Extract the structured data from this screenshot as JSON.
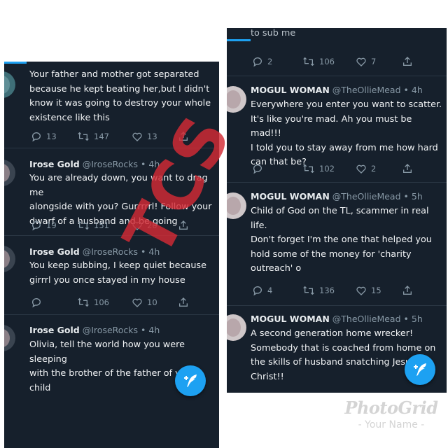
{
  "left_timeline": {
    "tweets": [
      {
        "name": "",
        "handle": "",
        "time": "",
        "text_lines": [
          "Your father and mother got separated",
          "because  he kept beating her,but I didn't",
          "know it was going to destroy  your whole",
          "existence  like this"
        ],
        "replies": "13",
        "retweets": "147",
        "likes": "13"
      },
      {
        "name": "Irose Gold",
        "handle": "@IroseRocks",
        "time": "• 4h",
        "text_lines": [
          "You are already down, you want to drag me",
          "alongside  with you?  Gurrrrrl!  Follow your",
          "dwarf of a husband  and be going"
        ],
        "replies": "19",
        "retweets": "151",
        "likes": "20"
      },
      {
        "name": "Irose Gold",
        "handle": "@IroseRocks",
        "time": "• 4h",
        "text_lines": [
          "You keep subbing, I keep quiet because",
          "girrrl you once stayed in my house"
        ],
        "replies": "",
        "retweets": "106",
        "likes": "10"
      },
      {
        "name": "Irose Gold",
        "handle": "@IroseRocks",
        "time": "• 4h",
        "text_lines": [
          "Olivia, tell the world how you were sleeping",
          "with the brother of the father of your",
          "child"
        ],
        "replies": "",
        "retweets": "",
        "likes": ""
      }
    ]
  },
  "right_timeline": {
    "top_partial_text": "to sub me",
    "top_actions": {
      "replies": "2",
      "retweets": "106",
      "likes": "7"
    },
    "tweets": [
      {
        "name": "MOGUL WOMAN",
        "handle": "@TheOllieMead",
        "time": "• 4h",
        "text_lines": [
          "Everywhere you enter you want to scatter.",
          "It's like you're mad. Ah you must be mad!!!",
          "I told you to stay away from me how hard",
          "can that be?"
        ],
        "replies": "",
        "retweets": "102",
        "likes": "2"
      },
      {
        "name": "MOGUL WOMAN",
        "handle": "@TheOllieMead",
        "time": "• 5h",
        "text_lines": [
          "Child of God on the TL, scammer in real",
          "life.",
          "Don't forget I'm the one that helped you",
          "hold some of the money for 'charity",
          "outreach' o"
        ],
        "replies": "4",
        "retweets": "136",
        "likes": "15"
      },
      {
        "name": "MOGUL WOMAN",
        "handle": "@TheOllieMead",
        "time": "• 5h",
        "text_lines": [
          "A second generation home wrecker!",
          "Somebody that is coached from home on",
          "the skills of husband snatching Jesus",
          "Christ!!"
        ],
        "replies": "",
        "retweets": "",
        "likes": ""
      }
    ]
  },
  "watermark": {
    "text": "TCS",
    "color": "#d32b34"
  },
  "brand": {
    "logo": "PhotoGrid",
    "tagline": "- Your Name -"
  },
  "colors": {
    "background": "#16202c",
    "accent": "#1da1f2",
    "muted": "#8899a6"
  },
  "icons": {
    "reply": "reply-icon",
    "retweet": "retweet-icon",
    "like": "heart-icon",
    "compose": "compose-tweet-icon"
  }
}
